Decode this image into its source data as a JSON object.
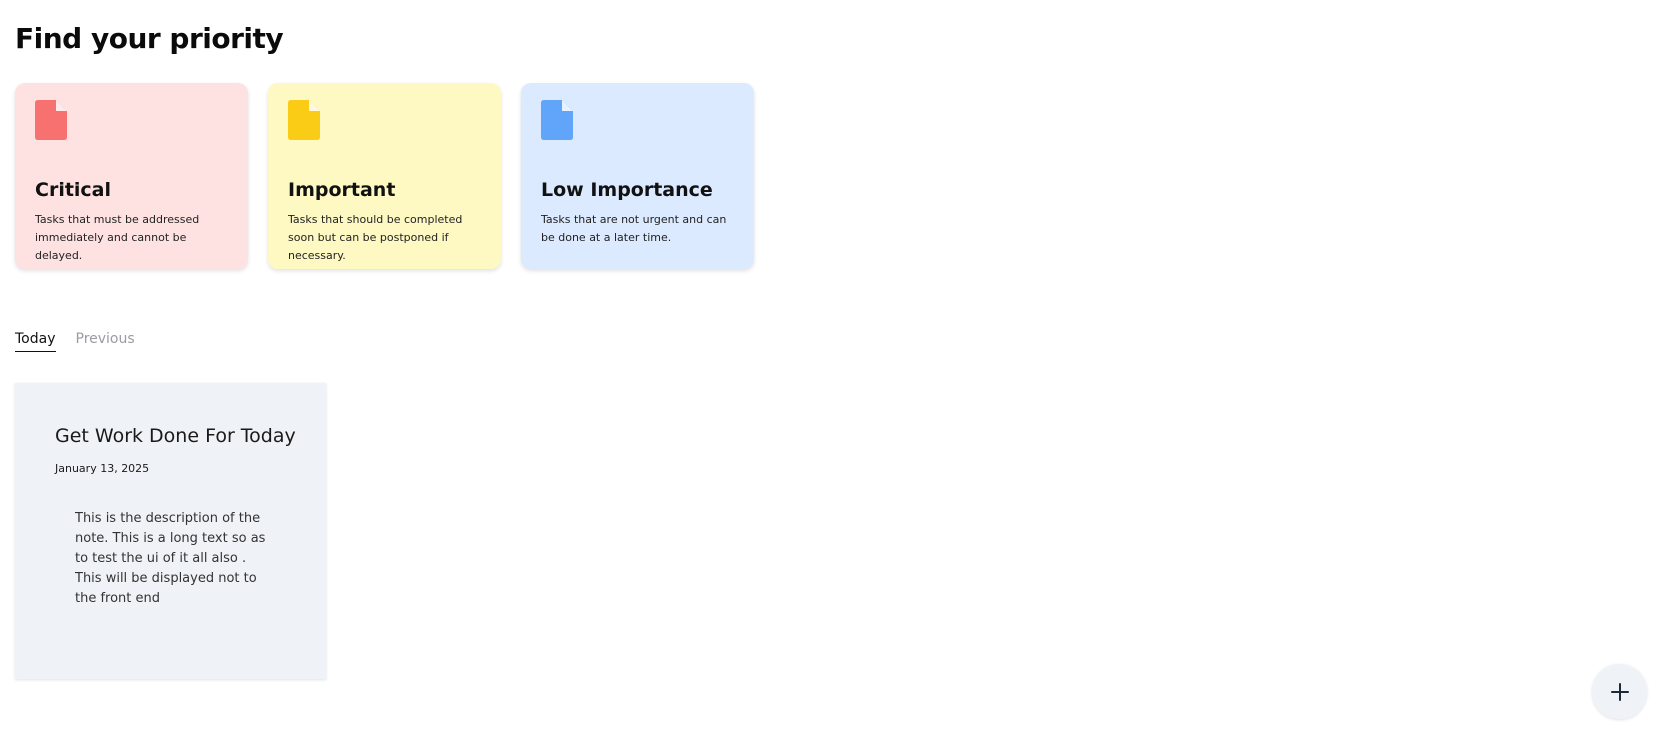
{
  "page": {
    "title": "Find your priority"
  },
  "priority_cards": [
    {
      "title": "Critical",
      "description": "Tasks that must be addressed immediately and cannot be delayed.",
      "background": "#fee2e2",
      "icon_color": "#f87171",
      "icon": "document-icon"
    },
    {
      "title": "Important",
      "description": "Tasks that should be completed soon but can be postponed if necessary.",
      "background": "#fef9c3",
      "icon_color": "#facc15",
      "icon": "document-icon"
    },
    {
      "title": "Low Importance",
      "description": "Tasks that are not urgent and can be done at a later time.",
      "background": "#dbeafe",
      "icon_color": "#60a5fa",
      "icon": "document-icon"
    }
  ],
  "tabs": [
    {
      "label": "Today",
      "active": true
    },
    {
      "label": "Previous",
      "active": false
    }
  ],
  "notes": [
    {
      "title": "Get Work Done For Today",
      "date": "January 13, 2025",
      "description": "This is the description of the note. This is a long text so as to test the ui of it all also . This will be displayed not to the front end"
    }
  ],
  "fab": {
    "icon": "plus-icon"
  }
}
